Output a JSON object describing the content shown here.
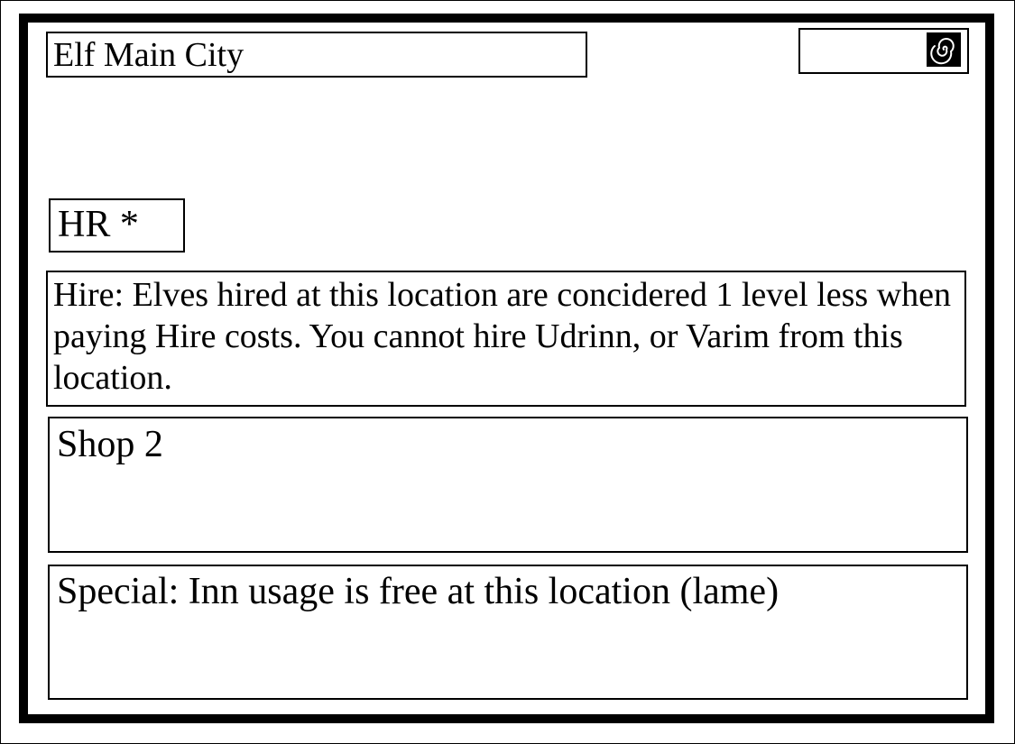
{
  "card": {
    "title": "Elf Main City",
    "icon": "spiral-icon",
    "hr_label": "HR *",
    "hire_text": "Hire: Elves hired at this location are concidered 1 level less when paying Hire costs. You cannot hire Udrinn, or Varim from this location.",
    "shop_text": "Shop 2",
    "special_text": "Special: Inn usage is free at this location (lame)"
  },
  "colors": {
    "ink": "#000000",
    "paper": "#ffffff"
  }
}
